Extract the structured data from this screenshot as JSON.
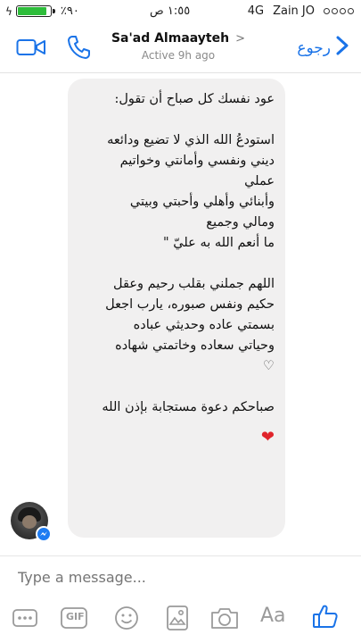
{
  "status_bar": {
    "battery_percent_label": "٪٩٠",
    "battery_level": 0.9,
    "time": "١:٥٥ ص",
    "network": "4G",
    "carrier": "Zain JO"
  },
  "header": {
    "contact_name": "Sa'ad Almaayteh",
    "status": "Active 9h ago",
    "back_label": "رجوع",
    "icons": [
      "video-call-icon",
      "phone-icon",
      "chevron-right-icon",
      "chevron-left-icon"
    ]
  },
  "message": {
    "lines": [
      "عود نفسك كل صباح أن تقول:",
      "",
      "استودعُ الله الذي لا تضيع ودائعه",
      "ديني ونفسي وأمانتي وخواتيم",
      "عملي",
      "وأبنائي وأهلي وأحبتي وبيتي",
      "ومالي وجميع",
      "ما أنعم الله به عليّ \"",
      "",
      "اللهم جملني بقلب رحيم وعقل",
      "حكيم ونفس صبوره، يارب اجعل",
      "بسمتي عاده وحديثي عباده",
      "وحياتي سعاده وخاتمتي شهاده",
      "",
      "",
      "صباحكم دعوة مستجابة بإذن الله"
    ],
    "heart_outline": "♡",
    "heart_red": "❤"
  },
  "composer": {
    "placeholder": "Type a message...",
    "gif_label": "GIF",
    "aa_label": "Aa",
    "icons": [
      "more-icon",
      "gif-icon",
      "emoji-icon",
      "photo-icon",
      "camera-icon",
      "aa-icon",
      "like-icon"
    ]
  },
  "colors": {
    "accent": "#1a73e8",
    "bubble": "#f1f0f0",
    "battery": "#2ebd3b",
    "heart": "#e0242b"
  }
}
